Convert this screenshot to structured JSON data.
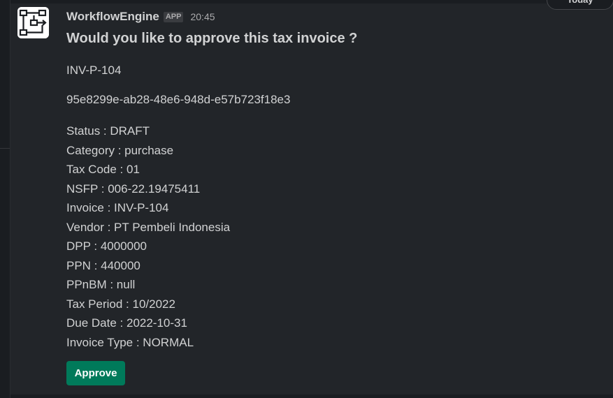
{
  "date_divider": "Today",
  "message": {
    "sender": "WorkflowEngine",
    "badge": "APP",
    "timestamp": "20:45",
    "avatar_icon": "workflow-diagram-icon",
    "title": "Would you like to approve this tax invoice ?",
    "invoice_ref": "INV-P-104",
    "uuid": "95e8299e-ab28-48e6-948d-e57b723f18e3",
    "fields": [
      "Status : DRAFT",
      "Category : purchase",
      "Tax Code : 01",
      "NSFP : 006-22.19475411",
      "Invoice : INV-P-104",
      "Vendor : PT Pembeli Indonesia",
      "DPP : 4000000",
      "PPN : 440000",
      "PPnBM : null",
      "Tax Period : 10/2022",
      "Due Date : 2022-10-31",
      "Invoice Type : NORMAL"
    ],
    "approve_label": "Approve"
  },
  "colors": {
    "background": "#1a1d21",
    "message_hover": "#222529",
    "approve_button": "#007a5a",
    "text": "#d1d2d3"
  }
}
